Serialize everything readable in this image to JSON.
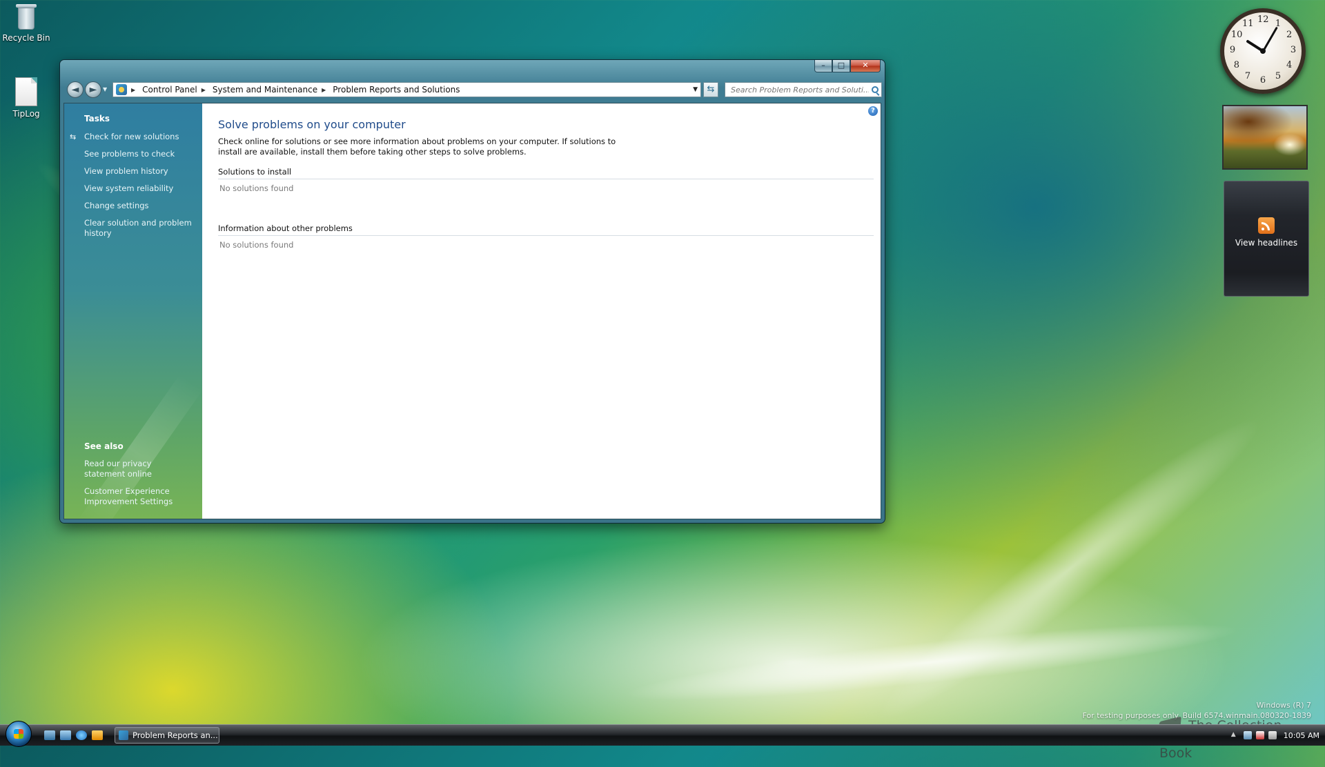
{
  "desktop": {
    "icons": [
      {
        "label": "Recycle Bin",
        "icon": "recycle-bin-icon"
      },
      {
        "label": "TipLog",
        "icon": "text-document-icon"
      }
    ],
    "watermark": {
      "line1": "Windows (R) 7",
      "line2": "For testing purposes only. Build 6574.winmain.080320-1839"
    },
    "brand": "The Collection Book"
  },
  "window": {
    "caption_buttons": {
      "minimize": "–",
      "maximize": "□",
      "close": "✕"
    },
    "nav": {
      "back_glyph": "◄",
      "forward_glyph": "►"
    },
    "breadcrumb": [
      "Control Panel",
      "System and Maintenance",
      "Problem Reports and Solutions"
    ],
    "search": {
      "placeholder": "Search Problem Reports and Soluti..."
    },
    "left_pane": {
      "tasks_heading": "Tasks",
      "tasks": [
        "Check for new solutions",
        "See problems to check",
        "View problem history",
        "View system reliability",
        "Change settings",
        "Clear solution and problem history"
      ],
      "see_also_heading": "See also",
      "see_also": [
        "Read our privacy statement online",
        "Customer Experience Improvement Settings"
      ]
    },
    "content": {
      "title": "Solve problems on your computer",
      "description": "Check online for solutions or see more information about problems on your computer. If solutions to install are available, install them before taking other steps to solve problems.",
      "sections": [
        {
          "heading": "Solutions to install",
          "empty_text": "No solutions found"
        },
        {
          "heading": "Information about other problems",
          "empty_text": "No solutions found"
        }
      ],
      "help_glyph": "?"
    }
  },
  "gadgets": {
    "clock": {
      "numbers": [
        "12",
        "1",
        "2",
        "3",
        "4",
        "5",
        "6",
        "7",
        "8",
        "9",
        "10",
        "11"
      ],
      "hour": 10,
      "minute": 5
    },
    "feed": {
      "label": "View headlines",
      "icon": "rss-icon"
    }
  },
  "taskbar": {
    "task_button": "Problem Reports an...",
    "clock": "10:05 AM"
  }
}
